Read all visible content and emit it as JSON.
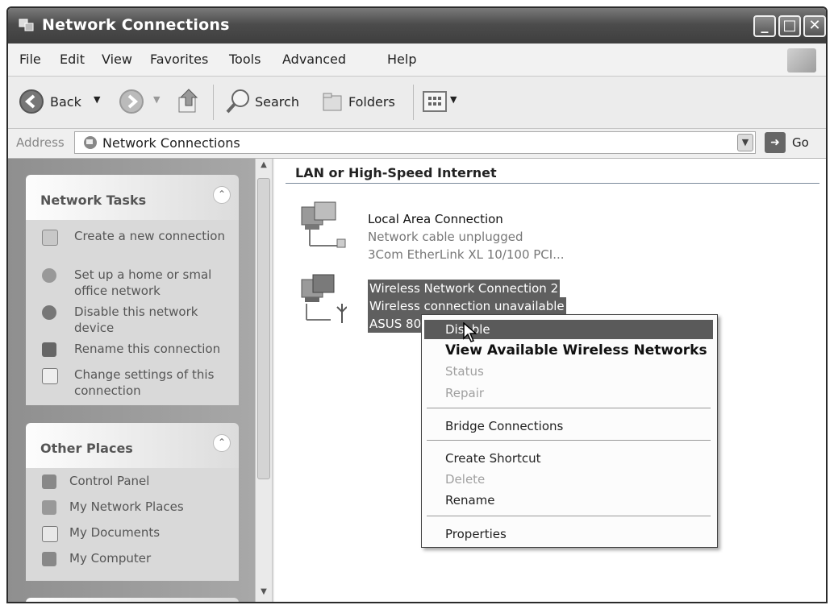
{
  "window": {
    "title": "Network Connections",
    "buttons": {
      "minimize": "_",
      "maximize": "□",
      "close": "✕"
    }
  },
  "menubar": {
    "items": [
      "File",
      "Edit",
      "View",
      "Favorites",
      "Tools",
      "Advanced",
      "Help"
    ]
  },
  "toolbar": {
    "back_label": "Back",
    "search_label": "Search",
    "folders_label": "Folders"
  },
  "address": {
    "label": "Address",
    "value": "Network Connections",
    "go_label": "Go"
  },
  "sidebar": {
    "network_tasks": {
      "title": "Network Tasks",
      "items": [
        {
          "label": "Create a new connection",
          "icon": "new-connection-icon"
        },
        {
          "label": "Set up a home or smal office network",
          "icon": "home-network-icon"
        },
        {
          "label": "Disable this network device",
          "icon": "disable-device-icon"
        },
        {
          "label": "Rename this connection",
          "icon": "rename-icon"
        },
        {
          "label": "Change settings of this connection",
          "icon": "settings-icon"
        }
      ]
    },
    "other_places": {
      "title": "Other Places",
      "items": [
        {
          "label": "Control Panel",
          "icon": "control-panel-icon"
        },
        {
          "label": "My Network Places",
          "icon": "network-places-icon"
        },
        {
          "label": "My Documents",
          "icon": "documents-icon"
        },
        {
          "label": "My Computer",
          "icon": "computer-icon"
        }
      ]
    }
  },
  "main": {
    "group_title": "LAN or High-Speed Internet",
    "connections": [
      {
        "name": "Local Area Connection",
        "status": "Network cable unplugged",
        "device": "3Com EtherLink XL 10/100 PCI..."
      },
      {
        "name": "Wireless Network Connection 2",
        "status": "Wireless connection unavailable",
        "device": "ASUS 80"
      }
    ]
  },
  "context_menu": {
    "disable": "Disable",
    "view_networks": "View Available Wireless Networks",
    "status": "Status",
    "repair": "Repair",
    "bridge": "Bridge Connections",
    "create_shortcut": "Create Shortcut",
    "delete": "Delete",
    "rename": "Rename",
    "properties": "Properties"
  }
}
